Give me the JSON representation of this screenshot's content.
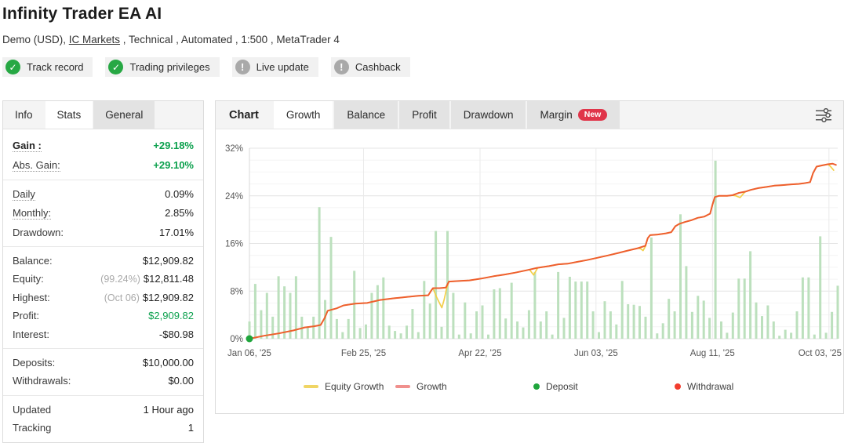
{
  "header": {
    "title": "Infinity Trader EA AI",
    "subtitle": {
      "prefix": "Demo (USD), ",
      "broker": "IC Markets",
      "suffix": " , Technical , Automated , 1:500 , MetaTrader 4"
    },
    "badges": [
      {
        "label": "Track record",
        "status": "ok"
      },
      {
        "label": "Trading privileges",
        "status": "ok"
      },
      {
        "label": "Live update",
        "status": "info"
      },
      {
        "label": "Cashback",
        "status": "info"
      }
    ]
  },
  "sidebar": {
    "tabs": [
      {
        "label": "Info"
      },
      {
        "label": "Stats"
      },
      {
        "label": "General"
      }
    ],
    "active_tab": "Stats",
    "stats": [
      {
        "label": "Gain :",
        "value": "+29.18%"
      },
      {
        "label": "Abs. Gain:",
        "value": "+29.10%"
      },
      {
        "label": "Daily",
        "value": "0.09%"
      },
      {
        "label": "Monthly:",
        "value": "2.85%"
      },
      {
        "label": "Drawdown:",
        "value": "17.01%"
      },
      {
        "label": "Balance:",
        "value": "$12,909.82"
      },
      {
        "label": "Equity:",
        "note": "(99.24%)",
        "value": "$12,811.48"
      },
      {
        "label": "Highest:",
        "note": "(Oct 06)",
        "value": "$12,909.82"
      },
      {
        "label": "Profit:",
        "value": "$2,909.82"
      },
      {
        "label": "Interest:",
        "value": "-$80.98"
      },
      {
        "label": "Deposits:",
        "value": "$10,000.00"
      },
      {
        "label": "Withdrawals:",
        "value": "$0.00"
      },
      {
        "label": "Updated",
        "value": "1 Hour ago"
      },
      {
        "label": "Tracking",
        "value": "1"
      }
    ]
  },
  "chart": {
    "panel_label": "Chart",
    "tabs": [
      {
        "label": "Growth"
      },
      {
        "label": "Balance"
      },
      {
        "label": "Profit"
      },
      {
        "label": "Drawdown"
      },
      {
        "label": "Margin",
        "badge": "New"
      }
    ],
    "active_tab": "Growth"
  },
  "chart_data": {
    "type": "line+bar",
    "y_unit": "%",
    "y_max": 32,
    "y_ticks": [
      0,
      8,
      16,
      24,
      32
    ],
    "x_ticks": [
      {
        "label": "Jan 06, '25",
        "pos": 0.0
      },
      {
        "label": "Feb 25, '25",
        "pos": 0.194
      },
      {
        "label": "Apr 22, '25",
        "pos": 0.392
      },
      {
        "label": "Jun 03, '25",
        "pos": 0.589
      },
      {
        "label": "Aug 11, '25",
        "pos": 0.787
      },
      {
        "label": "Oct 03, '25",
        "pos": 0.985
      }
    ],
    "series": {
      "growth": [
        [
          0,
          0
        ],
        [
          0.025,
          0.5
        ],
        [
          0.05,
          0.9
        ],
        [
          0.075,
          1.4
        ],
        [
          0.094,
          1.9
        ],
        [
          0.11,
          2.1
        ],
        [
          0.121,
          2.3
        ],
        [
          0.128,
          3.5
        ],
        [
          0.133,
          4.7
        ],
        [
          0.148,
          5.1
        ],
        [
          0.16,
          5.6
        ],
        [
          0.18,
          5.9
        ],
        [
          0.2,
          6
        ],
        [
          0.222,
          6.5
        ],
        [
          0.246,
          6.8
        ],
        [
          0.267,
          7
        ],
        [
          0.287,
          7.2
        ],
        [
          0.304,
          7.3
        ],
        [
          0.309,
          8.1
        ],
        [
          0.312,
          8.5
        ],
        [
          0.323,
          8.5
        ],
        [
          0.334,
          8.6
        ],
        [
          0.339,
          9.6
        ],
        [
          0.358,
          9.7
        ],
        [
          0.374,
          9.8
        ],
        [
          0.394,
          10.1
        ],
        [
          0.415,
          10.5
        ],
        [
          0.435,
          10.8
        ],
        [
          0.452,
          11.1
        ],
        [
          0.471,
          11.5
        ],
        [
          0.489,
          11.9
        ],
        [
          0.509,
          12.2
        ],
        [
          0.525,
          12.5
        ],
        [
          0.541,
          12.6
        ],
        [
          0.557,
          12.9
        ],
        [
          0.573,
          13.2
        ],
        [
          0.592,
          13.6
        ],
        [
          0.61,
          14
        ],
        [
          0.627,
          14.4
        ],
        [
          0.643,
          14.8
        ],
        [
          0.66,
          15.2
        ],
        [
          0.673,
          15.6
        ],
        [
          0.677,
          16.9
        ],
        [
          0.681,
          17.4
        ],
        [
          0.694,
          17.5
        ],
        [
          0.708,
          17.7
        ],
        [
          0.717,
          17.9
        ],
        [
          0.724,
          18.9
        ],
        [
          0.731,
          19.3
        ],
        [
          0.74,
          19.6
        ],
        [
          0.751,
          19.9
        ],
        [
          0.762,
          20.3
        ],
        [
          0.773,
          20.5
        ],
        [
          0.783,
          21
        ],
        [
          0.787,
          22.5
        ],
        [
          0.791,
          23.8
        ],
        [
          0.798,
          24
        ],
        [
          0.812,
          24
        ],
        [
          0.821,
          24.1
        ],
        [
          0.832,
          24.5
        ],
        [
          0.843,
          24.7
        ],
        [
          0.852,
          25
        ],
        [
          0.865,
          25.3
        ],
        [
          0.879,
          25.5
        ],
        [
          0.892,
          25.7
        ],
        [
          0.906,
          25.8
        ],
        [
          0.919,
          25.9
        ],
        [
          0.933,
          26
        ],
        [
          0.942,
          26.1
        ],
        [
          0.953,
          26.3
        ],
        [
          0.958,
          27.8
        ],
        [
          0.964,
          28.9
        ],
        [
          0.973,
          29.1
        ],
        [
          0.983,
          29.3
        ],
        [
          0.991,
          29.4
        ],
        [
          0.997,
          29.2
        ]
      ],
      "equity_growth": [
        [
          0,
          0
        ],
        [
          0.025,
          0.5
        ],
        [
          0.05,
          0.9
        ],
        [
          0.075,
          1.4
        ],
        [
          0.094,
          1.9
        ],
        [
          0.11,
          2.1
        ],
        [
          0.121,
          2.3
        ],
        [
          0.128,
          3.5
        ],
        [
          0.133,
          4.7
        ],
        [
          0.148,
          5.1
        ],
        [
          0.16,
          5.6
        ],
        [
          0.18,
          5.9
        ],
        [
          0.2,
          6
        ],
        [
          0.222,
          6.5
        ],
        [
          0.246,
          6.8
        ],
        [
          0.267,
          7
        ],
        [
          0.287,
          7.2
        ],
        [
          0.304,
          7.3
        ],
        [
          0.309,
          8.1
        ],
        [
          0.312,
          8.5
        ],
        [
          0.318,
          7
        ],
        [
          0.327,
          5.2
        ],
        [
          0.331,
          6.6
        ],
        [
          0.335,
          8.4
        ],
        [
          0.339,
          9.6
        ],
        [
          0.358,
          9.7
        ],
        [
          0.374,
          9.8
        ],
        [
          0.394,
          10.1
        ],
        [
          0.415,
          10.5
        ],
        [
          0.435,
          10.8
        ],
        [
          0.452,
          11.1
        ],
        [
          0.471,
          11.5
        ],
        [
          0.476,
          11.6
        ],
        [
          0.483,
          10.7
        ],
        [
          0.49,
          11.9
        ],
        [
          0.509,
          12.2
        ],
        [
          0.525,
          12.5
        ],
        [
          0.541,
          12.6
        ],
        [
          0.557,
          12.9
        ],
        [
          0.573,
          13.2
        ],
        [
          0.592,
          13.6
        ],
        [
          0.61,
          14
        ],
        [
          0.627,
          14.4
        ],
        [
          0.643,
          14.8
        ],
        [
          0.66,
          15.2
        ],
        [
          0.665,
          15.1
        ],
        [
          0.669,
          14.8
        ],
        [
          0.673,
          15.5
        ],
        [
          0.677,
          16.9
        ],
        [
          0.681,
          17.4
        ],
        [
          0.694,
          17.5
        ],
        [
          0.708,
          17.7
        ],
        [
          0.717,
          17.9
        ],
        [
          0.724,
          18.9
        ],
        [
          0.731,
          19.3
        ],
        [
          0.74,
          19.6
        ],
        [
          0.751,
          19.9
        ],
        [
          0.762,
          20.3
        ],
        [
          0.773,
          20.5
        ],
        [
          0.783,
          21
        ],
        [
          0.787,
          22.5
        ],
        [
          0.791,
          23.8
        ],
        [
          0.798,
          24
        ],
        [
          0.812,
          24
        ],
        [
          0.821,
          24.1
        ],
        [
          0.827,
          24
        ],
        [
          0.834,
          23.7
        ],
        [
          0.84,
          24.4
        ],
        [
          0.843,
          24.7
        ],
        [
          0.852,
          25
        ],
        [
          0.865,
          25.3
        ],
        [
          0.879,
          25.5
        ],
        [
          0.892,
          25.7
        ],
        [
          0.906,
          25.8
        ],
        [
          0.919,
          25.9
        ],
        [
          0.933,
          26
        ],
        [
          0.942,
          26.1
        ],
        [
          0.953,
          26.3
        ],
        [
          0.958,
          27.8
        ],
        [
          0.964,
          28.9
        ],
        [
          0.973,
          29.1
        ],
        [
          0.983,
          29.3
        ],
        [
          0.987,
          29
        ],
        [
          0.993,
          28.3
        ]
      ],
      "daily_bars": [
        2.9,
        9.2,
        4.8,
        7.7,
        3.7,
        10.5,
        8.8,
        7.7,
        10.5,
        3.7,
        2,
        3.7,
        22.1,
        6.5,
        17.1,
        3.3,
        1.1,
        3.3,
        11.4,
        1.8,
        2.4,
        7.7,
        9,
        10.3,
        2.2,
        1.3,
        0.9,
        2.2,
        5,
        1.1,
        9.7,
        5.9,
        18.1,
        2,
        18.1,
        7.7,
        0.7,
        6.1,
        0.9,
        4.6,
        5.6,
        0.7,
        8.3,
        8.5,
        3.4,
        9.4,
        2.9,
        1.9,
        4.8,
        11.2,
        2.9,
        4.6,
        0.7,
        11.2,
        3.5,
        10.4,
        9.6,
        9.6,
        9.6,
        4.6,
        1.1,
        6.3,
        4.6,
        2.4,
        9.7,
        5.8,
        5.7,
        5.5,
        3.7,
        17,
        0.9,
        2.6,
        6.7,
        4.6,
        20.9,
        12.2,
        4.5,
        7.2,
        6.4,
        3.5,
        29.9,
        2.9,
        1,
        4.4,
        10.1,
        10.1,
        14.7,
        6.1,
        3.8,
        5.6,
        2.9,
        0.5,
        1.5,
        1,
        4.6,
        10.3,
        10.3,
        0.7,
        17.2,
        1,
        4.5,
        8.9
      ]
    },
    "markers": [
      {
        "type": "deposit",
        "x": 0,
        "y": 0
      }
    ],
    "legend": [
      {
        "label": "Equity Growth",
        "shape": "line",
        "color": "#f0d564"
      },
      {
        "label": "Growth",
        "shape": "line",
        "color": "#f0908d"
      },
      {
        "label": "Deposit",
        "shape": "dot",
        "color": "#1fa53c"
      },
      {
        "label": "Withdrawal",
        "shape": "dot",
        "color": "#f23d2e"
      }
    ],
    "colors": {
      "bar": "#bce0bd",
      "growth": "#ee5f2e",
      "equity": "#f2cf4a",
      "deposit": "#1fa53c",
      "withdrawal": "#f23d2e",
      "grid_major": "#e4e4e4",
      "grid_minor": "#f4f4f4",
      "axis": "#d8d8d8"
    }
  },
  "theme": {
    "accent-green": "#0ba04d",
    "badge-ok": "#27a844",
    "badge-info": "#a9a9a9",
    "new-badge": "#e0354a"
  }
}
